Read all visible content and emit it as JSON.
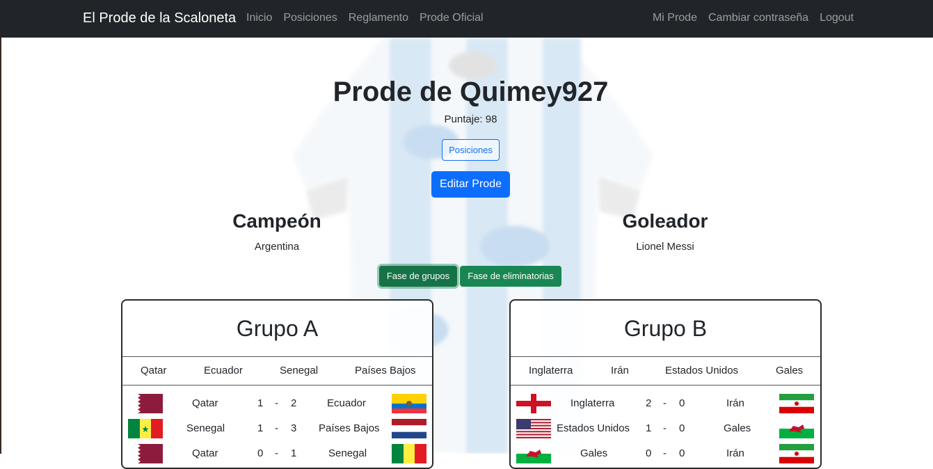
{
  "navbar": {
    "brand": "El Prode de la Scaloneta",
    "left_links": [
      "Inicio",
      "Posiciones",
      "Reglamento",
      "Prode Oficial"
    ],
    "right_links": [
      "Mi Prode",
      "Cambiar contraseña",
      "Logout"
    ]
  },
  "profile": {
    "title": "Prode de Quimey927",
    "score": "Puntaje: 98",
    "positions_button": "Posiciones",
    "edit_button": "Editar Prode"
  },
  "picks": {
    "champion_label": "Campeón",
    "champion_value": "Argentina",
    "scorer_label": "Goleador",
    "scorer_value": "Lionel Messi"
  },
  "phase_buttons": {
    "groups": "Fase de grupos",
    "knockout": "Fase de eliminatorias"
  },
  "groups": [
    {
      "title": "Grupo A",
      "teams": [
        "Qatar",
        "Ecuador",
        "Senegal",
        "Países Bajos"
      ],
      "matches": [
        {
          "home": "Qatar",
          "home_goals": "1",
          "sep": "-",
          "away_goals": "2",
          "away": "Ecuador",
          "home_flag": "qatar-flag",
          "away_flag": "ecuador-flag"
        },
        {
          "home": "Senegal",
          "home_goals": "1",
          "sep": "-",
          "away_goals": "3",
          "away": "Países Bajos",
          "home_flag": "senegal-flag",
          "away_flag": "netherlands-flag"
        },
        {
          "home": "Qatar",
          "home_goals": "0",
          "sep": "-",
          "away_goals": "1",
          "away": "Senegal",
          "home_flag": "qatar-flag",
          "away_flag": "senegal-flag"
        }
      ]
    },
    {
      "title": "Grupo B",
      "teams": [
        "Inglaterra",
        "Irán",
        "Estados Unidos",
        "Gales"
      ],
      "matches": [
        {
          "home": "Inglaterra",
          "home_goals": "2",
          "sep": "-",
          "away_goals": "0",
          "away": "Irán",
          "home_flag": "england-flag",
          "away_flag": "iran-flag"
        },
        {
          "home": "Estados Unidos",
          "home_goals": "1",
          "sep": "-",
          "away_goals": "0",
          "away": "Gales",
          "home_flag": "usa-flag",
          "away_flag": "wales-flag"
        },
        {
          "home": "Gales",
          "home_goals": "0",
          "sep": "-",
          "away_goals": "0",
          "away": "Irán",
          "home_flag": "wales-flag",
          "away_flag": "iran-flag"
        }
      ]
    }
  ],
  "colors": {
    "navbar": "#212529",
    "primary": "#0d6efd",
    "success": "#198754"
  }
}
